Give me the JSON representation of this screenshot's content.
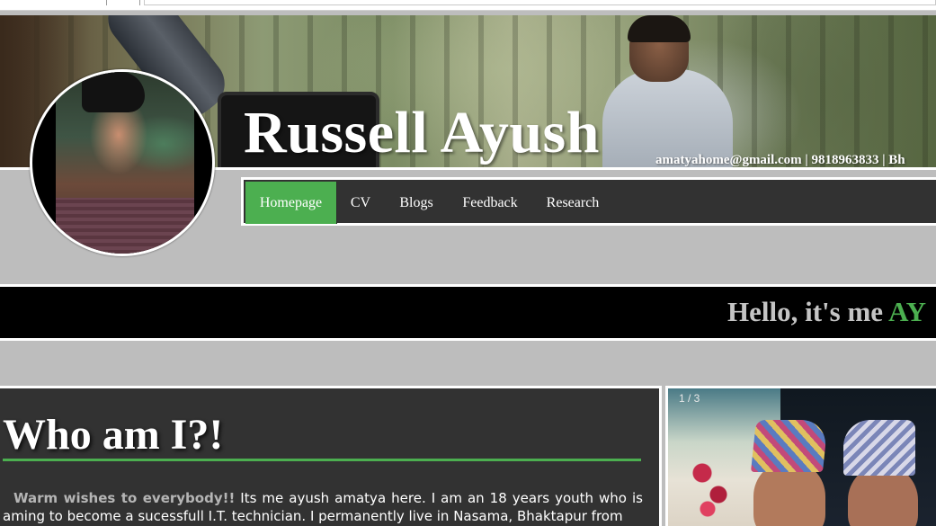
{
  "header": {
    "site_title": "Russell Ayush",
    "contact": "amatyahome@gmail.com | 9818963833 | Bh"
  },
  "nav": {
    "items": [
      {
        "label": "Homepage",
        "active": true
      },
      {
        "label": "CV",
        "active": false
      },
      {
        "label": "Blogs",
        "active": false
      },
      {
        "label": "Feedback",
        "active": false
      },
      {
        "label": "Research",
        "active": false
      }
    ]
  },
  "hello": {
    "prefix": "Hello, it's me ",
    "highlight": "AY"
  },
  "about": {
    "heading": "Who am I?!",
    "lead": "Warm wishes to everybody!!",
    "body": " Its me ayush amatya here. I am an 18 years youth who is aming to become a sucessfull I.T. technician. I permanently live in Nasama, Bhaktapur from"
  },
  "slideshow": {
    "counter": "1 / 3"
  },
  "colors": {
    "accent": "#4caf50",
    "nav_bg": "#323232",
    "page_bg": "#bdbdbd",
    "hello_bg": "#000000"
  }
}
